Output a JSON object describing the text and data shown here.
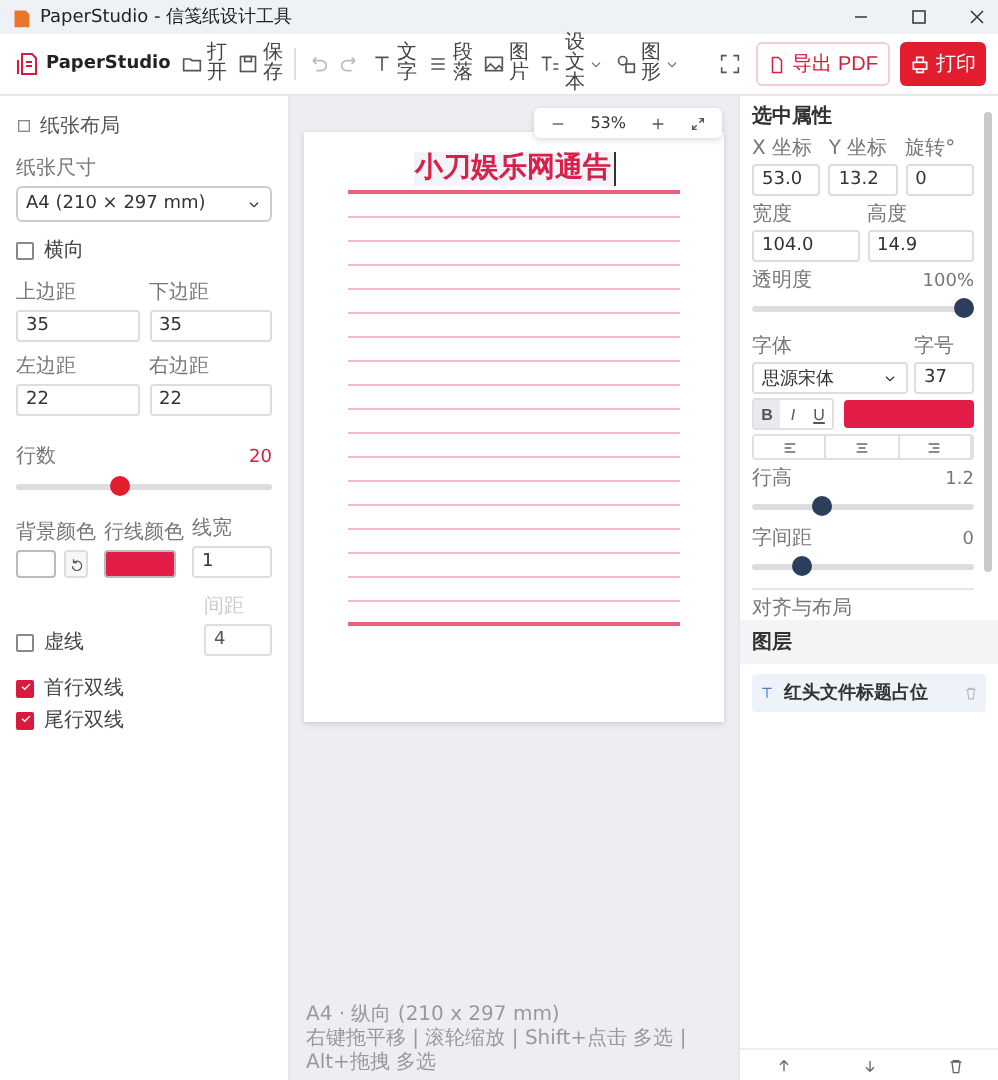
{
  "window": {
    "title": "PaperStudio - 信笺纸设计工具"
  },
  "toolbar": {
    "brand": "PaperStudio",
    "buttons": [
      {
        "kind": "open",
        "label": "打开"
      },
      {
        "kind": "save",
        "label": "保存"
      },
      {
        "kind": "undo",
        "disabled": true
      },
      {
        "kind": "redo",
        "disabled": true
      },
      {
        "kind": "text",
        "label": "文字"
      },
      {
        "kind": "paragraph",
        "label": "段落"
      },
      {
        "kind": "image",
        "label": "图片"
      },
      {
        "kind": "preset",
        "label": "设文本",
        "dropdown": true
      },
      {
        "kind": "shape",
        "label": "图形",
        "dropdown": true
      },
      {
        "kind": "fullscreen"
      }
    ],
    "export": {
      "label": "导出 PDF"
    },
    "print": {
      "label": "打印"
    }
  },
  "paper_panel": {
    "title": "纸张布局",
    "size_label": "纸张尺寸",
    "size_value": "A4 (210 × 297 mm)",
    "landscape": {
      "label": "横向",
      "checked": false
    },
    "margins": [
      {
        "label": "上边距",
        "value": "35"
      },
      {
        "label": "下边距",
        "value": "35"
      },
      {
        "label": "左边距",
        "value": "22"
      },
      {
        "label": "右边距",
        "value": "22"
      }
    ],
    "rows": {
      "label": "行数",
      "value": "20",
      "level": 0.4
    },
    "bg_color": {
      "label": "背景颜色",
      "color": "#ffffff"
    },
    "line_color": {
      "label": "行线颜色",
      "color": "#e11d48"
    },
    "line_width": {
      "label": "线宽",
      "value": "1"
    },
    "dashed": {
      "label": "虚线",
      "checked": false
    },
    "dash_gap": {
      "label": "间距",
      "value": "4",
      "disabled": true
    },
    "double_first": {
      "label": "首行双线",
      "checked": true
    },
    "double_last": {
      "label": "尾行双线",
      "checked": true
    }
  },
  "canvas": {
    "zoom": "53%",
    "paper": {
      "title": "小刀娱乐网通告"
    },
    "status": {
      "page_info": "A4 · 纵向 (210 x 297 mm)",
      "hints": "右键拖平移 | 滚轮缩放 | Shift+点击 多选 | Alt+拖拽 多选"
    }
  },
  "properties": {
    "title": "选中属性",
    "position": [
      {
        "label": "X 坐标",
        "value": "53.0"
      },
      {
        "label": "Y 坐标",
        "value": "13.2"
      },
      {
        "label": "旋转°",
        "value": "0"
      }
    ],
    "size": [
      {
        "label": "宽度",
        "value": "104.0"
      },
      {
        "label": "高度",
        "value": "14.9"
      }
    ],
    "opacity": {
      "label": "透明度",
      "reading": "100%",
      "level": 1
    },
    "font": {
      "label": "字体",
      "value": "思源宋体"
    },
    "font_size": {
      "label": "字号",
      "value": "37"
    },
    "styles": [
      {
        "label": "B",
        "selected": true
      },
      {
        "label": "I",
        "selected": false
      },
      {
        "label": "U",
        "selected": false
      }
    ],
    "text_color": {
      "color": "#e11d48"
    },
    "align": [
      {
        "kind": "left"
      },
      {
        "kind": "center"
      },
      {
        "kind": "right"
      }
    ],
    "line_height": {
      "label": "行高",
      "reading": "1.2",
      "level": 0.3
    },
    "letter_spacing": {
      "label": "字间距",
      "reading": "0",
      "level": 0.2
    },
    "section": "对齐与布局"
  },
  "layers": {
    "title": "图层",
    "items": [
      {
        "label": "红头文件标题占位",
        "selected": true
      }
    ]
  }
}
